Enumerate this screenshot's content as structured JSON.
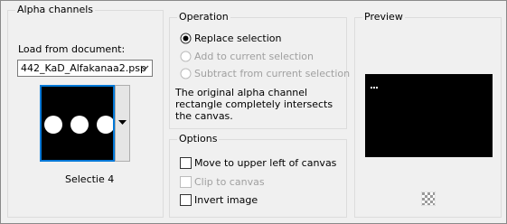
{
  "alpha": {
    "title": "Alpha channels",
    "load_label": "Load from document:",
    "document": "442_KaD_Alfakanaa2.psp",
    "selection_name": "Selectie 4"
  },
  "operation": {
    "title": "Operation",
    "options": [
      {
        "label": "Replace selection",
        "checked": true,
        "enabled": true
      },
      {
        "label": "Add to current selection",
        "checked": false,
        "enabled": false
      },
      {
        "label": "Subtract from current selection",
        "checked": false,
        "enabled": false
      }
    ],
    "description": "The original alpha channel rectangle completely intersects the canvas."
  },
  "options": {
    "title": "Options",
    "items": [
      {
        "label": "Move to upper left of canvas",
        "checked": false,
        "enabled": true
      },
      {
        "label": "Clip to canvas",
        "checked": false,
        "enabled": false
      },
      {
        "label": "Invert image",
        "checked": false,
        "enabled": true
      }
    ]
  },
  "preview": {
    "title": "Preview",
    "background": "#000000",
    "toggle_icon": "checkerboard-transparency-icon"
  },
  "colors": {
    "accent": "#0078d7",
    "panel": "#f0f0f0"
  }
}
